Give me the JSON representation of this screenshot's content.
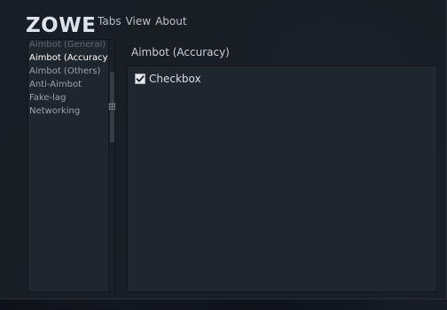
{
  "app": {
    "title": "ZOWE"
  },
  "menu": {
    "items": [
      "Tabs",
      "View",
      "About"
    ]
  },
  "sidebar": {
    "items": [
      {
        "label": "Aimbot (General)",
        "state": "partial"
      },
      {
        "label": "Aimbot (Accuracy)",
        "state": "active"
      },
      {
        "label": "Aimbot (Others)",
        "state": "normal"
      },
      {
        "label": "Anti-Aimbot",
        "state": "normal"
      },
      {
        "label": "Fake-lag",
        "state": "normal"
      },
      {
        "label": "Networking",
        "state": "normal"
      }
    ]
  },
  "content": {
    "title": "Aimbot (Accuracy)",
    "checkbox": {
      "label": "Checkbox",
      "checked": true
    }
  },
  "colors": {
    "accent": "#ffffff",
    "window_bg": "#1a1f25",
    "panel_bg": "#20262d"
  },
  "icons": {
    "checkbox": "checkmark-icon",
    "resize": "grip-icon"
  }
}
